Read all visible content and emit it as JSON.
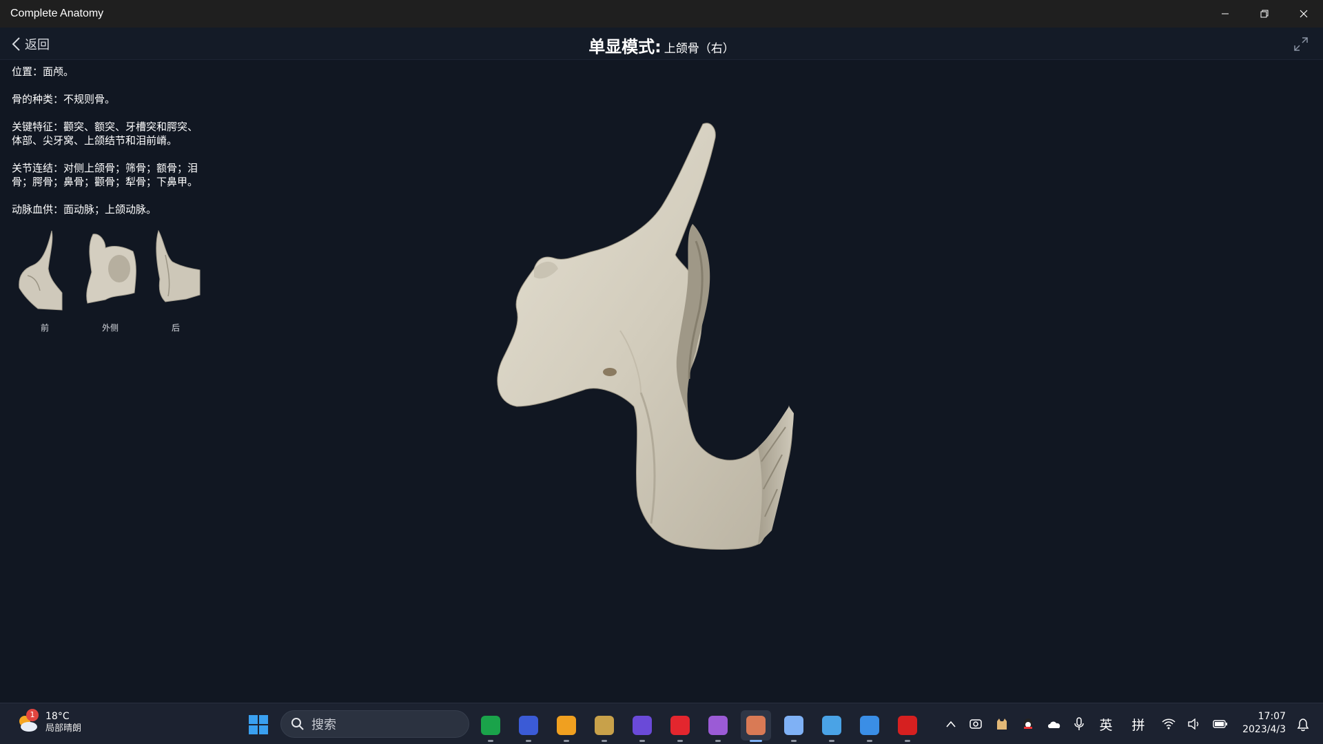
{
  "window": {
    "title": "Complete Anatomy"
  },
  "header": {
    "back_label": "返回",
    "mode_label": "单显模式:",
    "mode_value": "上颌骨（右）"
  },
  "info": {
    "location": "位置：面颅。",
    "bone_type": "骨的种类：不规则骨。",
    "key_features_1": "关键特征：颧突、额突、牙槽突和腭突、",
    "key_features_2": "体部、尖牙窝、上颌结节和泪前嵴。",
    "articulations_1": "关节连结：对侧上颌骨；筛骨；额骨；泪",
    "articulations_2": "骨；腭骨；鼻骨；颧骨；犁骨；下鼻甲。",
    "arterial_supply": "动脉血供：面动脉；上颌动脉。"
  },
  "thumbnails": [
    {
      "label": "前"
    },
    {
      "label": "外侧"
    },
    {
      "label": "后"
    }
  ],
  "taskbar": {
    "weather": {
      "temp": "18°C",
      "desc": "局部晴朗",
      "badge": "1"
    },
    "search_placeholder": "搜索",
    "apps": [
      {
        "icon": "sheets-app-icon",
        "color": "#1aa34a"
      },
      {
        "icon": "cat-app-icon",
        "color": "#3b5bd6"
      },
      {
        "icon": "g-app-icon",
        "color": "#f0a020"
      },
      {
        "icon": "league-app-icon",
        "color": "#c8a14a"
      },
      {
        "icon": "crystal-app-icon",
        "color": "#6a4ad8"
      },
      {
        "icon": "netease-music-icon",
        "color": "#e3262e"
      },
      {
        "icon": "study-app-icon",
        "color": "#9b5bd6"
      },
      {
        "icon": "complete-anatomy-icon",
        "color": "#d97a55"
      },
      {
        "icon": "recycle-app-icon",
        "color": "#7fb1f5"
      },
      {
        "icon": "chart-app-icon",
        "color": "#4aa3e6"
      },
      {
        "icon": "paint-app-icon",
        "color": "#3a8ee6"
      },
      {
        "icon": "acrobat-app-icon",
        "color": "#d62020"
      }
    ],
    "ime_lang": "英",
    "ime_mode": "拼",
    "clock_time": "17:07",
    "clock_date": "2023/4/3"
  }
}
